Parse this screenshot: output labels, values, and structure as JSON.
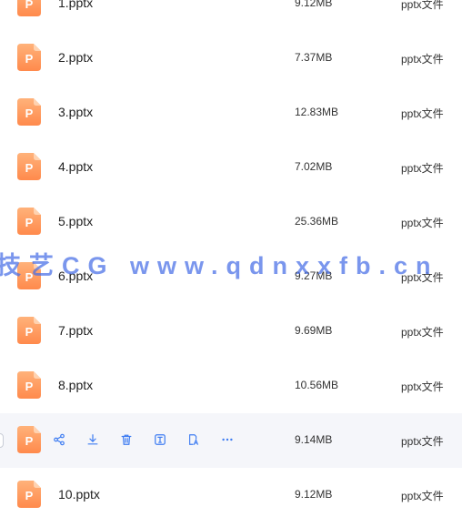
{
  "colors": {
    "icon_top": "#ffb27a",
    "icon_bottom": "#ff8a4c",
    "action_blue": "#3f7df2",
    "watermark": "#466ee6"
  },
  "files": [
    {
      "name": "1.pptx",
      "size": "9.12MB",
      "type": "pptx文件"
    },
    {
      "name": "2.pptx",
      "size": "7.37MB",
      "type": "pptx文件"
    },
    {
      "name": "3.pptx",
      "size": "12.83MB",
      "type": "pptx文件"
    },
    {
      "name": "4.pptx",
      "size": "7.02MB",
      "type": "pptx文件"
    },
    {
      "name": "5.pptx",
      "size": "25.36MB",
      "type": "pptx文件"
    },
    {
      "name": "6.pptx",
      "size": "9.27MB",
      "type": "pptx文件"
    },
    {
      "name": "7.pptx",
      "size": "9.69MB",
      "type": "pptx文件"
    },
    {
      "name": "8.pptx",
      "size": "10.56MB",
      "type": "pptx文件"
    },
    {
      "name": "9.pptx",
      "size": "9.14MB",
      "type": "pptx文件",
      "hovered": true
    },
    {
      "name": "10.pptx",
      "size": "9.12MB",
      "type": "pptx文件"
    }
  ],
  "hover_actions": [
    "share-icon",
    "download-icon",
    "delete-icon",
    "rename-icon",
    "translate-icon",
    "more-icon"
  ],
  "icon_letter": "P",
  "watermark_text": "技艺CG www.qdnxxfb.cn"
}
